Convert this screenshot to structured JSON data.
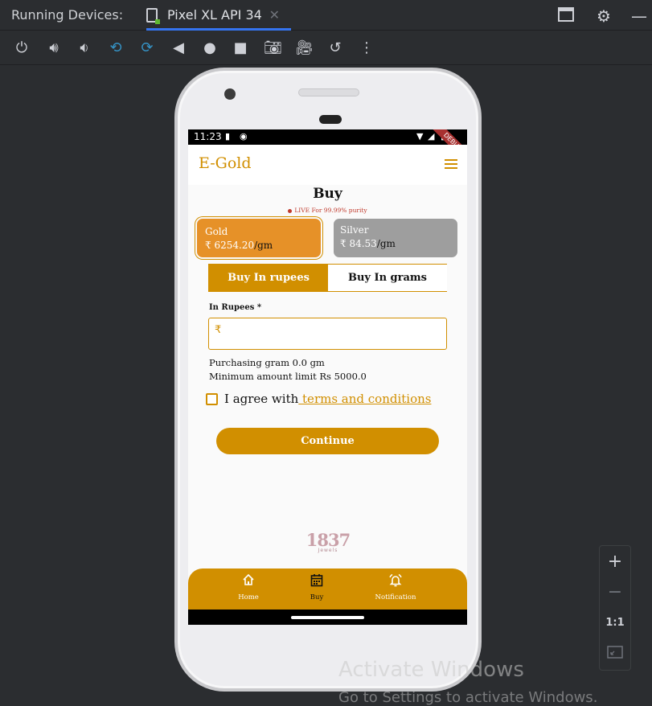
{
  "ide": {
    "title": "Running Devices:",
    "tab_label": "Pixel XL API 34",
    "tab_close": "✕"
  },
  "status_bar": {
    "time": "11:23",
    "debug_badge": "DEBUG"
  },
  "app": {
    "title": "E-Gold",
    "page_heading": "Buy",
    "live_text": "LIVE For 99.99% purity",
    "cards": {
      "gold": {
        "name": "Gold",
        "price": "₹ 6254.20",
        "unit": "/gm"
      },
      "silver": {
        "name": "Silver",
        "price": "₹ 84.53",
        "unit": "/gm"
      }
    },
    "toggle": {
      "rupees_label": "Buy In rupees",
      "grams_label": "Buy In grams",
      "selected": "rupees"
    },
    "amount_field": {
      "label": "In Rupees *",
      "prefix": "₹",
      "value": ""
    },
    "purchasing_text": "Purchasing gram 0.0 gm",
    "minimum_text": "Minimum amount limit Rs 5000.0",
    "agree_text": "I agree with",
    "terms_text": " terms and conditions",
    "agree_checked": false,
    "continue_label": "Continue",
    "logo": {
      "number": "1837",
      "subtitle": "Jewels"
    },
    "bottom_nav": [
      {
        "label": "Home",
        "icon": "home-icon",
        "active": false
      },
      {
        "label": "Buy",
        "icon": "calendar-icon",
        "active": true
      },
      {
        "label": "Notification",
        "icon": "bell-icon",
        "active": false
      }
    ]
  },
  "zoom": {
    "zoom_in": "+",
    "zoom_out": "−",
    "actual_size": "1:1"
  },
  "watermark": {
    "line1": "Activate Windows",
    "line2": "Go to Settings to activate Windows."
  },
  "colors": {
    "accent": "#d18f00",
    "gold_card": "#e69128",
    "silver_card": "#9e9e9e",
    "ide_bg": "#2b2d30"
  }
}
